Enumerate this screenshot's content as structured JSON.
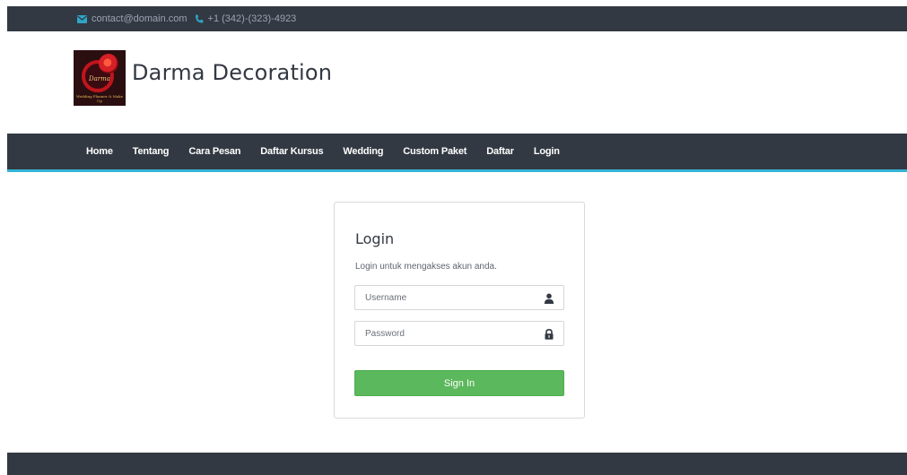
{
  "topbar": {
    "email": "contact@domain.com",
    "phone": "+1 (342)-(323)-4923",
    "icons": [
      "envelope-icon",
      "phone-icon"
    ]
  },
  "brand": {
    "name": "Darma Decoration",
    "logo_text": "Darma",
    "logo_tagline": "Wedding Planner & Make Up"
  },
  "nav": {
    "items": [
      "Home",
      "Tentang",
      "Cara Pesan",
      "Daftar Kursus",
      "Wedding",
      "Custom Paket",
      "Daftar",
      "Login"
    ]
  },
  "login": {
    "title": "Login",
    "subtitle": "Login untuk mengakses akun anda.",
    "username_placeholder": "Username",
    "password_placeholder": "Password",
    "submit_label": "Sign In"
  },
  "colors": {
    "dark": "#333942",
    "accent": "#36b3d8",
    "button": "#5cb85c"
  }
}
